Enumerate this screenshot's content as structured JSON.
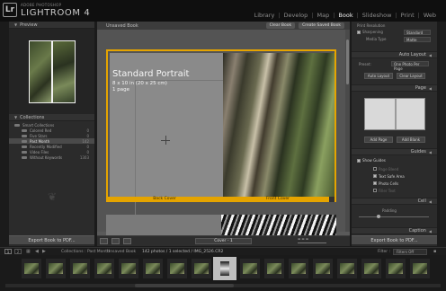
{
  "app": {
    "brand_small": "ADOBE PHOTOSHOP",
    "brand_big": "LIGHTROOM 4",
    "logo": "Lr"
  },
  "modules": [
    "Library",
    "Develop",
    "Map",
    "Book",
    "Slideshow",
    "Print",
    "Web"
  ],
  "active_module": "Book",
  "left_panel": {
    "preview_title": "Preview",
    "collections_title": "Collections",
    "collections": [
      {
        "name": "Smart Collections",
        "count": ""
      },
      {
        "name": "Colored Red",
        "count": "0"
      },
      {
        "name": "Five Stars",
        "count": "0"
      },
      {
        "name": "Past Month",
        "count": "142"
      },
      {
        "name": "Recently Modified",
        "count": "0"
      },
      {
        "name": "Video Files",
        "count": "0"
      },
      {
        "name": "Without Keywords",
        "count": "1303"
      }
    ],
    "selected_collection": "Past Month",
    "export_button": "Export Book to PDF..."
  },
  "center": {
    "tab_label": "Unsaved Book",
    "clear_book": "Clear Book",
    "create_saved_book": "Create Saved Book",
    "book_title": "Standard Portrait",
    "book_size": "8 x 10 in (20 x 25 cm)",
    "book_pages": "1 page",
    "back_cover": "Back Cover",
    "front_cover": "Front Cover",
    "page_select": "Cover - 1"
  },
  "right_panel": {
    "print_res_label": "Print Resolution",
    "sharpening_label": "Sharpening",
    "sharpening_value": "Standard",
    "media_type_label": "Media Type",
    "media_type_value": "Matte",
    "auto_layout_title": "Auto Layout",
    "preset_label": "Preset:",
    "preset_value": "One Photo Per Page",
    "auto_layout_btn": "Auto Layout",
    "clear_layout_btn": "Clear Layout",
    "page_title": "Page",
    "add_page_btn": "Add Page",
    "add_blank_btn": "Add Blank",
    "guides_title": "Guides",
    "show_guides": "Show Guides",
    "guide_items": [
      {
        "label": "Page Bleed",
        "checked": false
      },
      {
        "label": "Text Safe Area",
        "checked": true
      },
      {
        "label": "Photo Cells",
        "checked": true
      },
      {
        "label": "Filler Text",
        "checked": false
      }
    ],
    "cell_title": "Cell",
    "padding_label": "Padding",
    "caption_title": "Caption",
    "export_button": "Export Book to PDF..."
  },
  "filmstrip": {
    "breadcrumb": "Collections : Past Month",
    "book_name": "Unsaved Book",
    "photo_info": "142 photos / 1 selected / IMG_2526.CR2",
    "filter_label": "Filter :",
    "filter_value": "Filters Off",
    "page_numbers": [
      "1",
      "2"
    ]
  }
}
